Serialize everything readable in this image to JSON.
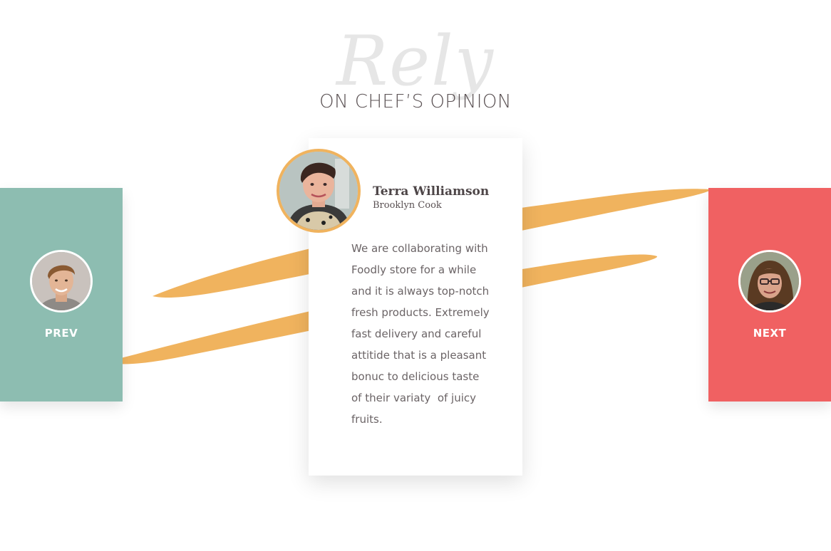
{
  "header": {
    "script_title": "Rely",
    "title": "ON CHEF’S OPINION"
  },
  "colors": {
    "prev_card": "#8dbdb1",
    "next_card": "#f06162",
    "accent_brush": "#f0b35e",
    "text_dark": "#4d4547"
  },
  "nav": {
    "prev_label": "PREV",
    "next_label": "NEXT"
  },
  "testimonial": {
    "name": "Terra Williamson",
    "role": "Brooklyn Cook",
    "quote_lines": [
      "We are collaborating with",
      "Foodly store for a while",
      "and it is always top-notch",
      "fresh products. Extremely",
      "fast delivery and careful",
      "attitide that is a pleasant",
      "bonuc to delicious taste",
      "of their variaty  of juicy",
      "fruits."
    ]
  },
  "icons": {
    "prev_avatar": "man-avatar",
    "main_avatar": "woman-short-hair-avatar",
    "next_avatar": "woman-glasses-avatar"
  }
}
